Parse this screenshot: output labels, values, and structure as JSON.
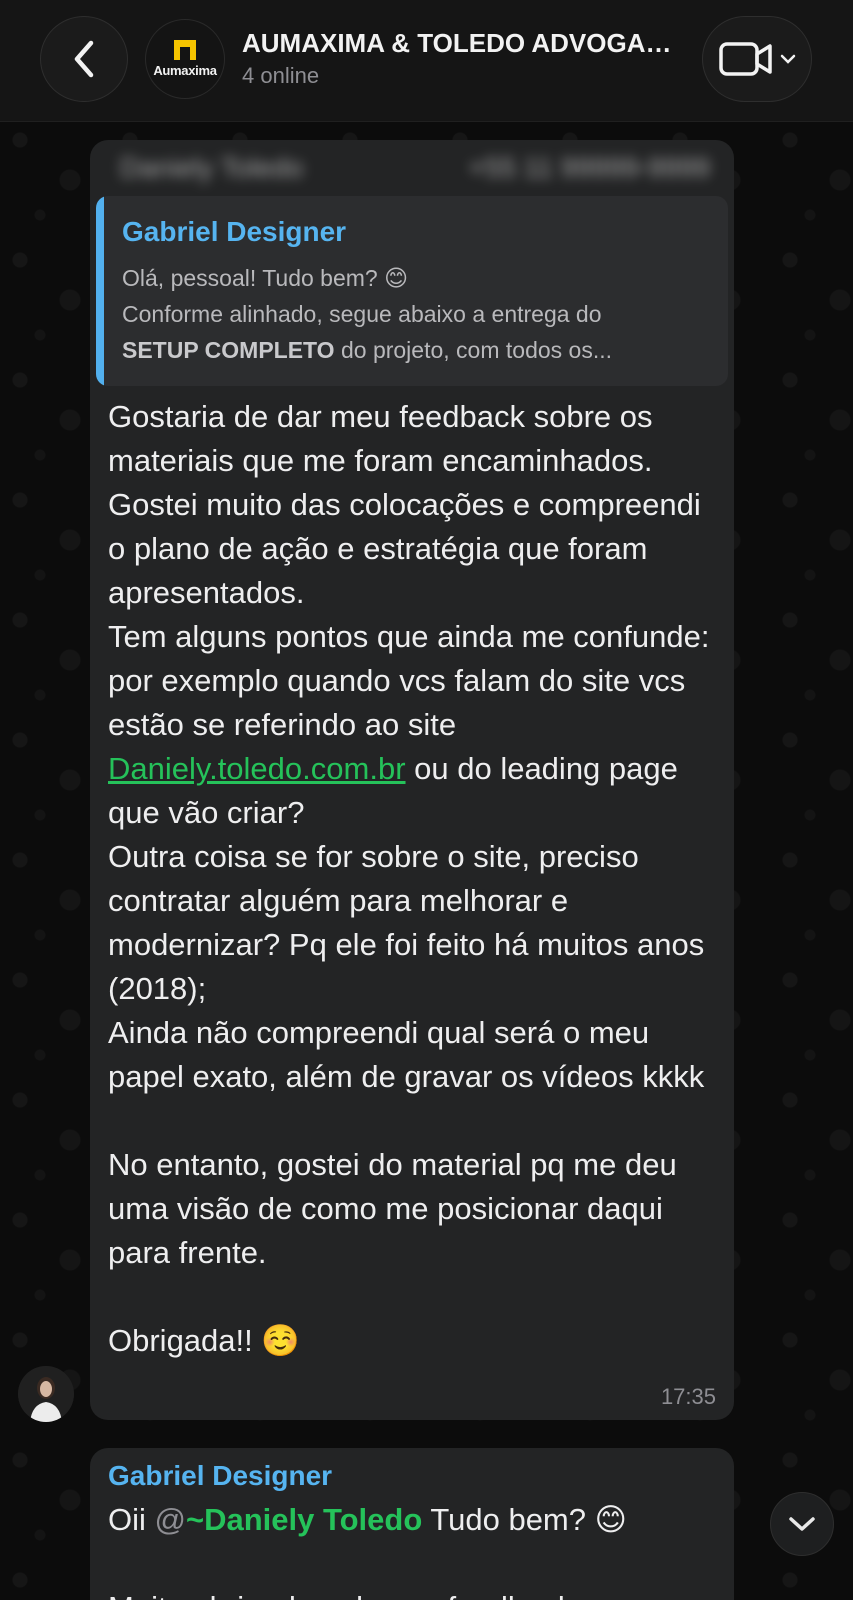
{
  "header": {
    "back_icon": "chevron-left-icon",
    "group_logo_text": "Aumaxima",
    "title": "AUMAXIMA & TOLEDO ADVOGADOS",
    "status": "4 online",
    "video_icon": "video-camera-icon"
  },
  "message1": {
    "sender_blurred": "Daniely Toledo",
    "sender_phone_blurred": "+55 11 99999-9999",
    "quote": {
      "author": "Gabriel Designer",
      "line1": "Olá, pessoal! Tudo bem? 😊",
      "line2": "Conforme alinhado, segue abaixo a entrega do",
      "line3_bold": "SETUP COMPLETO",
      "line3_rest": " do projeto, com todos os..."
    },
    "body": {
      "p1": "Gostaria de dar meu feedback sobre os materiais que me foram encaminhados. Gostei muito das colocações e compreendi o plano de ação e estratégia que foram apresentados.",
      "p2_before_link": "Tem alguns pontos que ainda me confunde: por exemplo quando vcs falam do site vcs estão se referindo ao site ",
      "p2_link": "Daniely.toledo.com.br",
      "p2_after_link": " ou do leading page que vão criar?",
      "p3": "Outra coisa se for sobre o site, preciso contratar alguém para melhorar e modernizar? Pq ele foi feito há muitos anos (2018);",
      "p4": "Ainda não compreendi qual será o meu papel exato, além de gravar os vídeos kkkk",
      "p5": "No entanto, gostei do material pq me deu uma visão de como me posicionar daqui para frente.",
      "p6": "Obrigada!! ☺️"
    },
    "time": "17:35"
  },
  "message2": {
    "author": "Gabriel Designer",
    "greeting_start": "Oii ",
    "mention_at": "@",
    "mention_name": "~Daniely Toledo",
    "greeting_end": " Tudo bem? 😊",
    "line2": "Muito obrigado pelo seu feedback e"
  },
  "scroll_down_icon": "chevron-down-icon"
}
